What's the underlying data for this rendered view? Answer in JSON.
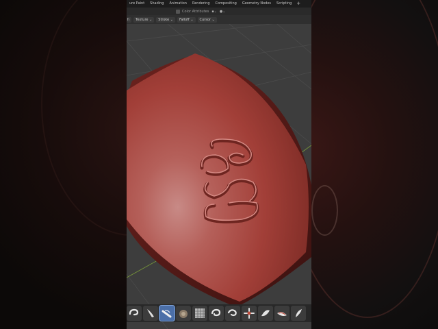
{
  "workspace_tabs": [
    {
      "label": "ure Paint"
    },
    {
      "label": "Shading"
    },
    {
      "label": "Animation"
    },
    {
      "label": "Rendering"
    },
    {
      "label": "Compositing"
    },
    {
      "label": "Geometry Nodes"
    },
    {
      "label": "Scripting"
    },
    {
      "label": "+"
    }
  ],
  "header": {
    "color_attributes_label": "Color Attributes"
  },
  "tool_header": {
    "menus": [
      {
        "label": "h"
      },
      {
        "label": "Texture ⌄"
      },
      {
        "label": "Stroke ⌄"
      },
      {
        "label": "Falloff ⌄"
      },
      {
        "label": "Cursor ⌄"
      }
    ]
  },
  "toolshelf": {
    "tools": [
      {
        "icon": "draw-brush-icon"
      },
      {
        "icon": "clay-strips-brush-icon"
      },
      {
        "icon": "crease-brush-icon",
        "active": true
      },
      {
        "icon": "smooth-brush-icon"
      },
      {
        "icon": "scrape-texture-brush-icon"
      },
      {
        "icon": "grab-brush-icon"
      },
      {
        "icon": "snake-hook-brush-icon"
      },
      {
        "icon": "pose-brush-icon"
      },
      {
        "icon": "flatten-brush-icon"
      },
      {
        "icon": "blob-brush-icon"
      },
      {
        "icon": "pinch-brush-icon"
      }
    ]
  },
  "colors": {
    "mesh_red": "#a8423c",
    "viewport_bg": "#3d3d3d",
    "active_tool": "#4b6fa8"
  }
}
